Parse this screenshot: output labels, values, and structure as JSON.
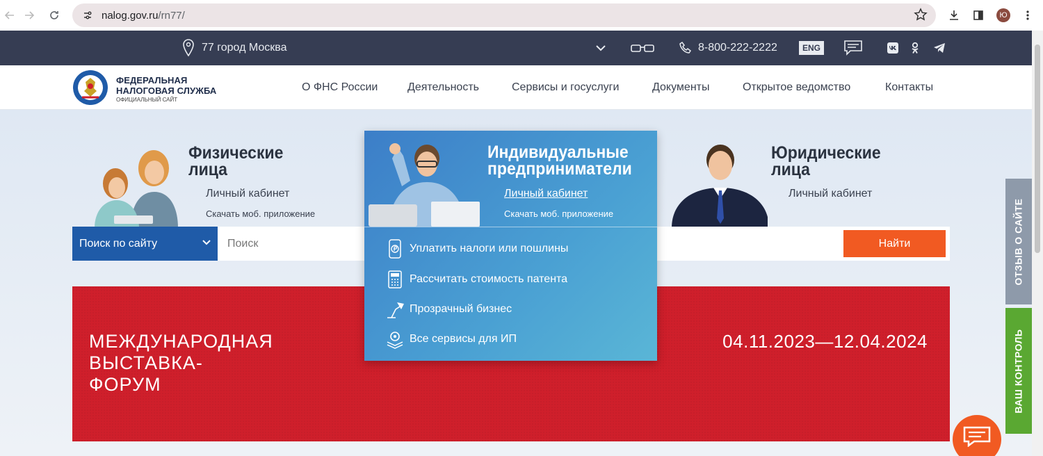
{
  "browser": {
    "url_domain": "nalog.gov.ru",
    "url_path": "/rn77/",
    "profile_initial": "Ю"
  },
  "topbar": {
    "region": "77 город Москва",
    "phone": "8-800-222-2222",
    "lang": "ENG"
  },
  "header": {
    "logo": {
      "line1": "ФЕДЕРАЛЬНАЯ",
      "line2": "НАЛОГОВАЯ СЛУЖБА",
      "line3": "ОФИЦИАЛЬНЫЙ САЙТ"
    },
    "menu": [
      "О ФНС России",
      "Деятельность",
      "Сервисы и госуслуги",
      "Документы",
      "Открытое ведомство",
      "Контакты"
    ]
  },
  "categories": {
    "individuals": {
      "title_line1": "Физические",
      "title_line2": "лица",
      "link": "Личный кабинет",
      "sub": "Скачать моб. приложение"
    },
    "entrepreneurs": {
      "title_line1": "Индивидуальные",
      "title_line2": "предприниматели",
      "link": "Личный кабинет",
      "sub": "Скачать моб. приложение",
      "services": [
        {
          "label": "Уплатить налоги или пошлины",
          "icon": "ruble-phone-icon"
        },
        {
          "label": "Рассчитать стоимость патента",
          "icon": "calculator-icon"
        },
        {
          "label": "Прозрачный бизнес",
          "icon": "lamp-icon"
        },
        {
          "label": "Все сервисы для ИП",
          "icon": "gear-stack-icon"
        }
      ]
    },
    "legal": {
      "title_line1": "Юридические",
      "title_line2": "лица",
      "link": "Личный кабинет"
    }
  },
  "search": {
    "select_label": "Поиск по сайту",
    "placeholder": "Поиск",
    "button": "Найти"
  },
  "banner": {
    "title_line1": "МЕЖДУНАРОДНАЯ",
    "title_line2": "ВЫСТАВКА-",
    "title_line3": "ФОРУМ",
    "dates": "04.11.2023—12.04.2024"
  },
  "side_tabs": {
    "feedback": "ОТЗЫВ О САЙТЕ",
    "control": "ВАШ КОНТРОЛЬ"
  },
  "colors": {
    "topbar": "#363d53",
    "search_select": "#1f5ba8",
    "accent_orange": "#f15a22",
    "banner_red": "#cf1f2b",
    "feedback_tab": "#8e9aaa",
    "control_tab": "#5aa832"
  }
}
